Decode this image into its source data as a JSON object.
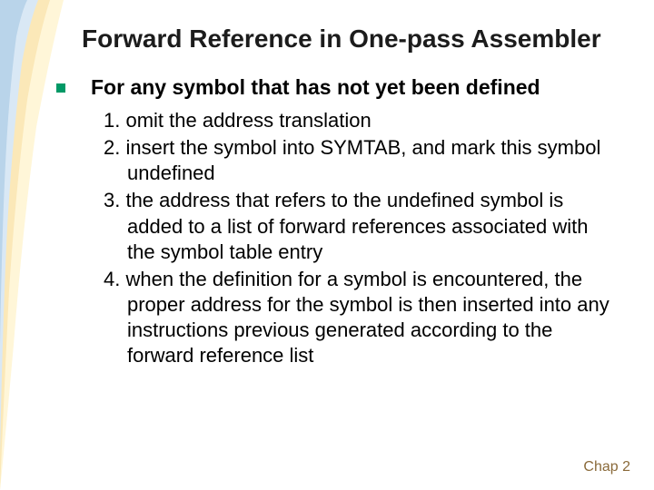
{
  "title": "Forward Reference in One-pass Assembler",
  "lead": "For any symbol that has not yet been defined",
  "items": [
    "1. omit the address translation",
    "2. insert the symbol into SYMTAB, and mark this symbol undefined",
    "3. the address that refers to the undefined symbol is added to a list of forward references associated with the symbol table entry",
    "4. when the definition for a symbol is encountered, the proper address for the symbol is then inserted into any instructions previous generated according to the forward reference list"
  ],
  "footer": "Chap 2"
}
